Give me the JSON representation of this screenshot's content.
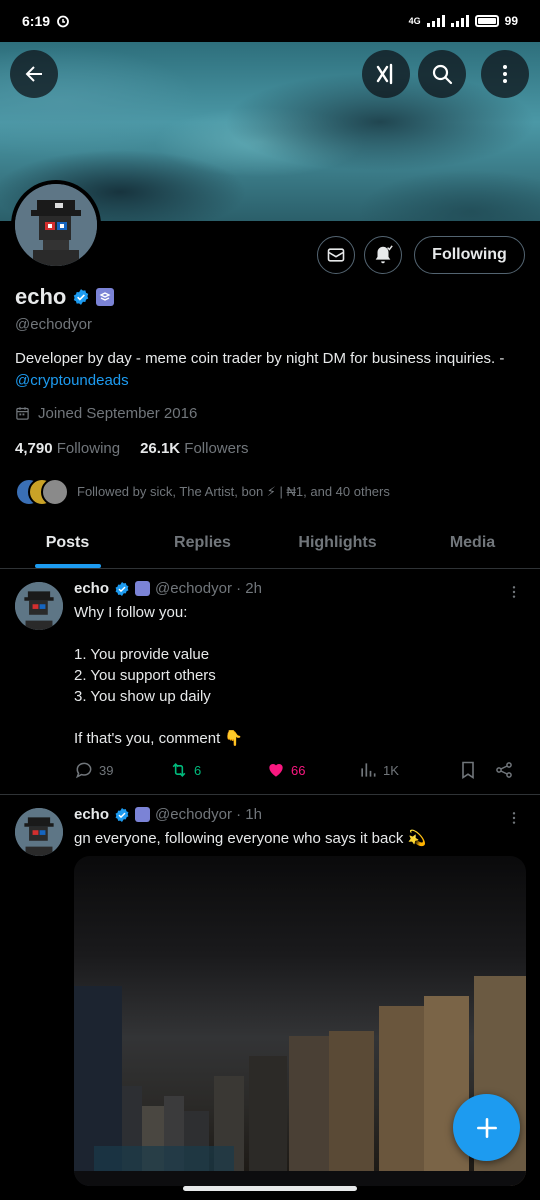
{
  "status_bar": {
    "time": "6:19",
    "network": "4G",
    "battery": "99"
  },
  "profile": {
    "name": "echo",
    "handle": "@echodyor",
    "bio_text": "Developer by day - meme coin trader by night DM for business inquiries. - ",
    "bio_link": "@cryptoundeads",
    "joined": "Joined September 2016",
    "following_count": "4,790",
    "following_label": "Following",
    "followers_count": "26.1K",
    "followers_label": "Followers",
    "followed_by": "Followed by sick, The Artist, bon ⚡ | ₦1, and 40 others",
    "follow_button": "Following"
  },
  "tabs": [
    {
      "label": "Posts",
      "active": true
    },
    {
      "label": "Replies",
      "active": false
    },
    {
      "label": "Highlights",
      "active": false
    },
    {
      "label": "Media",
      "active": false
    }
  ],
  "posts": [
    {
      "name": "echo",
      "meta": "@echodyor · 2h",
      "text": "Why I follow you:\n\n1. You provide value\n2. You support others\n3. You show up daily\n\nIf that's you, comment 👇",
      "replies": "39",
      "reposts": "6",
      "likes": "66",
      "views": "1K"
    },
    {
      "name": "echo",
      "meta": "@echodyor · 1h",
      "text": "gn everyone, following everyone who says it back 💫"
    }
  ],
  "colors": {
    "accent": "#1d9bf0",
    "repost": "#00ba7c",
    "like": "#f91880",
    "verified_purple": "#7b83d6"
  },
  "icons": [
    "back-arrow-icon",
    "grok-icon",
    "search-icon",
    "more-vertical-icon",
    "mail-icon",
    "bell-icon",
    "verified-icon",
    "calendar-icon",
    "reply-icon",
    "repost-icon",
    "heart-icon",
    "views-icon",
    "bookmark-icon",
    "share-icon",
    "plus-icon"
  ]
}
